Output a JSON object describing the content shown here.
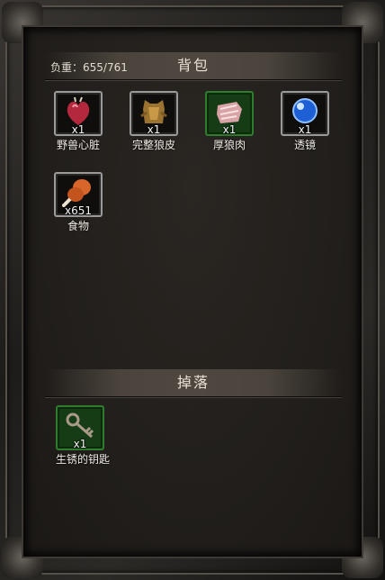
{
  "bag": {
    "title": "背包",
    "weight_label": "负重：655/761",
    "items": [
      {
        "name": "野兽心脏",
        "qty": "x1",
        "icon": "beast-heart-icon"
      },
      {
        "name": "完整狼皮",
        "qty": "x1",
        "icon": "wolf-pelt-icon"
      },
      {
        "name": "厚狼肉",
        "qty": "x1",
        "icon": "wolf-meat-icon",
        "rarity": "green"
      },
      {
        "name": "透镜",
        "qty": "x1",
        "icon": "lens-icon"
      },
      {
        "name": "食物",
        "qty": "x651",
        "icon": "food-drumstick-icon"
      }
    ]
  },
  "drop": {
    "title": "掉落",
    "items": [
      {
        "name": "生锈的钥匙",
        "qty": "x1",
        "icon": "rusty-key-icon",
        "rarity": "green"
      }
    ]
  },
  "colors": {
    "rarity_green": "#2e7d2e",
    "common_border": "#9a9a9a"
  }
}
